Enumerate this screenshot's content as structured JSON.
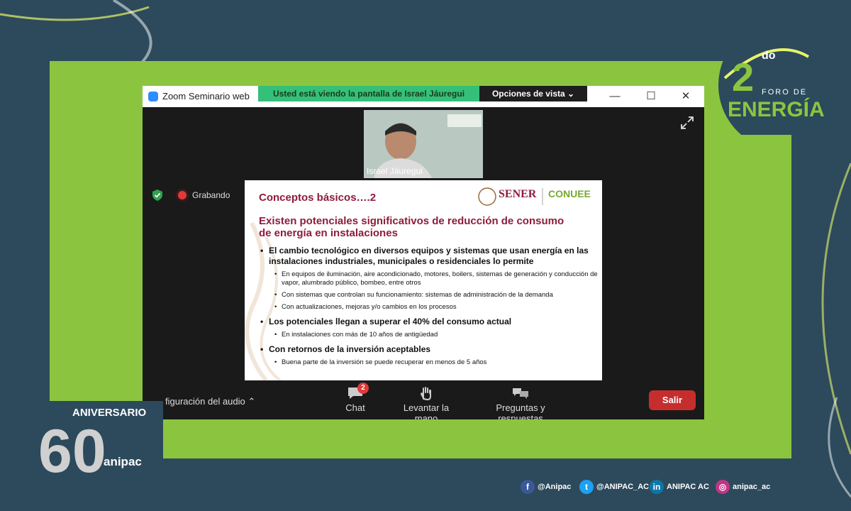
{
  "window": {
    "app_title": "Zoom Seminario web",
    "share_banner": "Usted está viendo la pantalla de Israel Jáuregui",
    "view_options": "Opciones de vista ⌄",
    "minimize": "—",
    "maximize": "☐",
    "close": "✕"
  },
  "video": {
    "participant_name": "Israel Jáuregui"
  },
  "recording": {
    "label": "Grabando"
  },
  "slide": {
    "title": "Conceptos básicos….2",
    "logo_sener": "SENER",
    "logo_conuee": "CONUEE",
    "heading": "Existen potenciales significativos de reducción de consumo de energía en instalaciones",
    "bullets": [
      "El cambio tecnológico en diversos equipos y sistemas que usan energía en las instalaciones industriales, municipales o residenciales lo permite",
      "En equipos de iluminación, aire acondicionado, motores, boilers, sistemas de generación y conducción de vapor, alumbrado público, bombeo,  entre otros",
      "Con sistemas que controlan su funcionamiento: sistemas de administración de la demanda",
      "Con actualizaciones, mejoras y/o cambios en los procesos",
      "Los potenciales llegan a superar el 40% del consumo actual",
      "En instalaciones con más de 10 años de antigüedad",
      "Con retornos de la inversión aceptables",
      "Buena parte de la inversión se puede recuperar en menos de 5 años"
    ]
  },
  "toolbar": {
    "audio_label": "figuración del audio  ⌃",
    "chat_label": "Chat",
    "chat_badge": "2",
    "raise_hand_label": "Levantar la mano",
    "qa_label": "Preguntas y respuestas",
    "leave_label": "Salir"
  },
  "branding": {
    "foro_sup": "do",
    "foro_line1": "FORO DE",
    "foro_line2": "ENERGÍA",
    "anipac_line1": "ANIVERSARIO",
    "anipac_line2": "anipac"
  },
  "social": {
    "facebook": "@Anipac",
    "twitter": "@ANIPAC_AC",
    "linkedin": "ANIPAC AC",
    "instagram": "anipac_ac"
  },
  "colors": {
    "frame_green": "#8bc540",
    "banner_green": "#35c07a",
    "slide_accent": "#8e1b3c",
    "leave_red": "#c62e2e"
  }
}
